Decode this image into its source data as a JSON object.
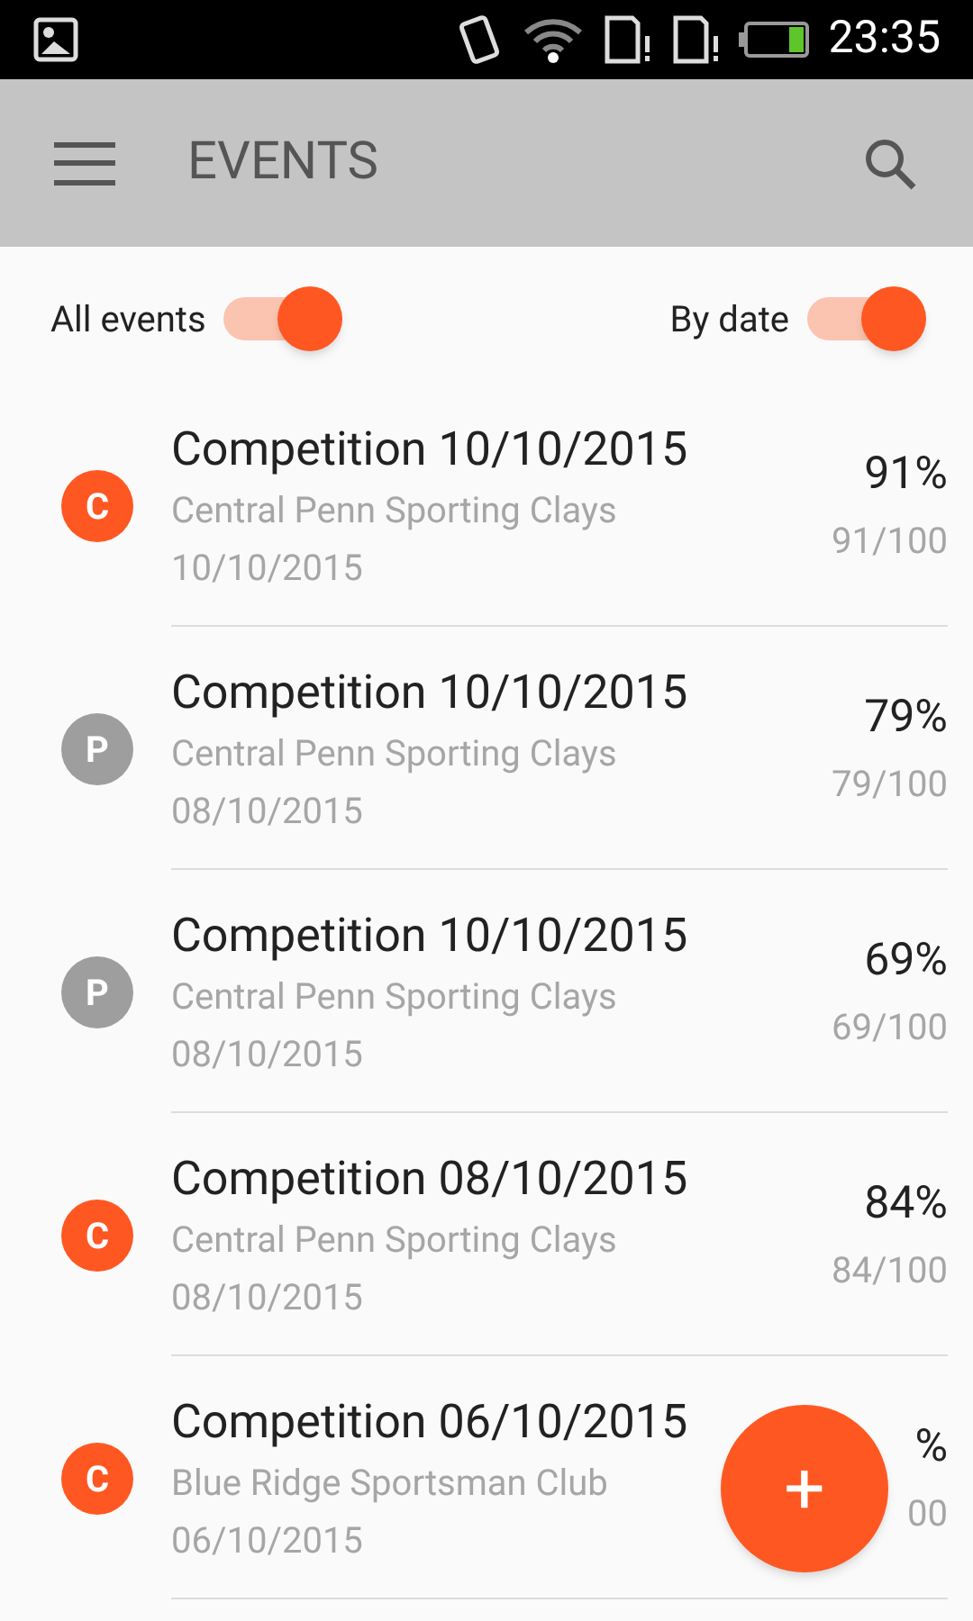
{
  "status_bar": {
    "time": "23:35"
  },
  "app_bar": {
    "title": "EVENTS"
  },
  "filters": [
    {
      "label": "All events",
      "on": true
    },
    {
      "label": "By date",
      "on": true
    }
  ],
  "events": [
    {
      "badge": "C",
      "color": "#ff5722",
      "title": "Competition 10/10/2015",
      "venue": "Central Penn Sporting Clays",
      "date": "10/10/2015",
      "percent": "91%",
      "score": "91/100"
    },
    {
      "badge": "P",
      "color": "#9e9e9e",
      "title": "Competition 10/10/2015",
      "venue": "Central Penn Sporting Clays",
      "date": "08/10/2015",
      "percent": "79%",
      "score": "79/100"
    },
    {
      "badge": "P",
      "color": "#9e9e9e",
      "title": "Competition 10/10/2015",
      "venue": "Central Penn Sporting Clays",
      "date": "08/10/2015",
      "percent": "69%",
      "score": "69/100"
    },
    {
      "badge": "C",
      "color": "#ff5722",
      "title": "Competition 08/10/2015",
      "venue": "Central Penn Sporting Clays",
      "date": "08/10/2015",
      "percent": "84%",
      "score": "84/100"
    },
    {
      "badge": "C",
      "color": "#ff5722",
      "title": "Competition 06/10/2015",
      "venue": "Blue Ridge Sportsman Club",
      "date": "06/10/2015",
      "percent": "%",
      "score": "00"
    }
  ],
  "fab": {
    "label": "+"
  }
}
